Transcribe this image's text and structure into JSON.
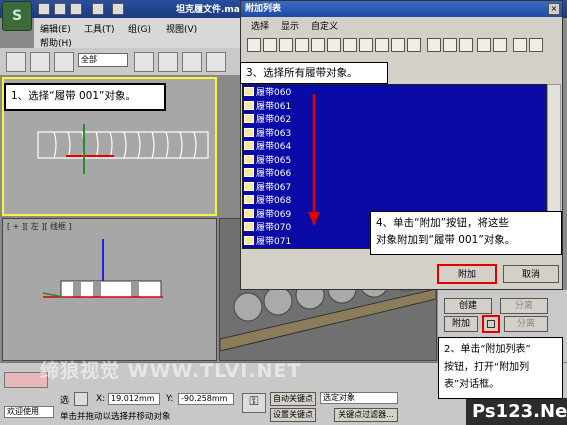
{
  "app": {
    "logo_text": "S",
    "doc_title": "坦克履文件.ma",
    "menu": [
      "编辑(E)",
      "工具(T)",
      "组(G)",
      "视图(V)",
      "帮助(H)"
    ],
    "selection_filter": "全部"
  },
  "viewports": {
    "left_label": "[ + ][ 左 ][ 线框 ]"
  },
  "dialog": {
    "title": "附加列表",
    "close_icon": "×",
    "menu": [
      "选择",
      "显示",
      "自定义"
    ],
    "items": [
      "履带060",
      "履带061",
      "履带062",
      "履带063",
      "履带064",
      "履带065",
      "履带066",
      "履带067",
      "履带068",
      "履带069",
      "履带070",
      "履带071"
    ],
    "attach_label": "附加",
    "cancel_label": "取消"
  },
  "cmdpanel": {
    "create_label": "创建",
    "detach_label": "分离",
    "attach_label": "附加",
    "split_label": "分离"
  },
  "statusbar": {
    "welcome": "欢迎使用",
    "hint": "单击并拖动以选择并移动对象",
    "x_label": "X:",
    "x_value": "19.012mm",
    "y_label": "Y:",
    "y_value": "-90.258mm",
    "autokey": "自动关键点",
    "selected_object": "选定对象",
    "set_key": "设置关键点",
    "key_filter": "关键点过滤器..."
  },
  "annotations": {
    "step1": "1、选择“履带 001”对象。",
    "step2_line1": "2、单击“附加列表”",
    "step2_line2": "按钮，打开“附加列",
    "step2_line3": "表”对话框。",
    "step3": "3、选择所有履带对象。",
    "step4_line1": "4、单击“附加”按钮，将这些",
    "step4_line2": "对象附加到“履带 001”对象。"
  },
  "watermark": "缔狼视觉 WWW.TLVI.NET",
  "brand": "Ps123.Net",
  "colors": {
    "highlight": "#f6f63a",
    "list_bg": "#0a0aa6",
    "title_bar": "#1d4aa6",
    "red": "#e00000"
  }
}
